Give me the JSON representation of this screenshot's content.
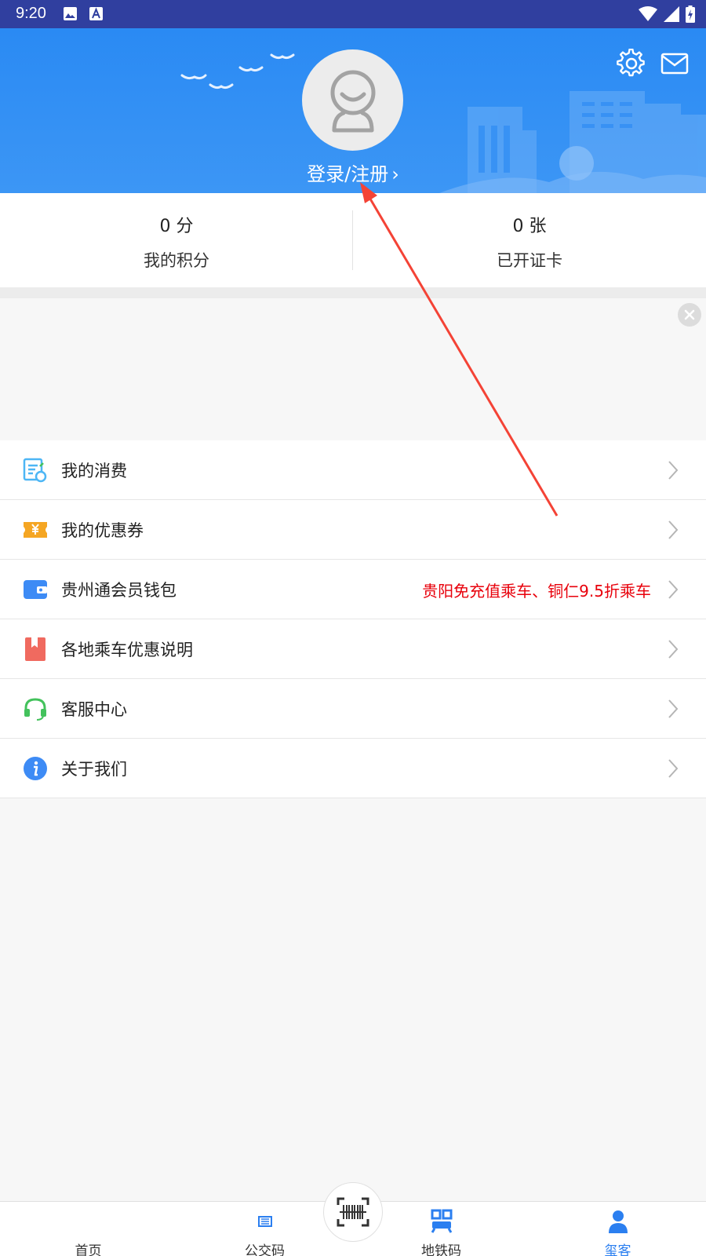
{
  "status_bar": {
    "time": "9:20"
  },
  "profile": {
    "login_label": "登录/注册",
    "chevron": "›"
  },
  "stats": [
    {
      "value": "0 分",
      "label": "我的积分"
    },
    {
      "value": "0 张",
      "label": "已开证卡"
    }
  ],
  "menu": [
    {
      "label": "我的消费",
      "icon": "receipt-icon",
      "color": "#4db6f5",
      "note": ""
    },
    {
      "label": "我的优惠券",
      "icon": "coupon-icon",
      "color": "#f5a623",
      "note": ""
    },
    {
      "label": "贵州通会员钱包",
      "icon": "wallet-icon",
      "color": "#3d8bf5",
      "note": "贵阳免充值乘车、铜仁9.5折乘车"
    },
    {
      "label": "各地乘车优惠说明",
      "icon": "bookmark-icon",
      "color": "#f06a5f",
      "note": ""
    },
    {
      "label": "客服中心",
      "icon": "headset-icon",
      "color": "#43c25c",
      "note": ""
    },
    {
      "label": "关于我们",
      "icon": "info-icon",
      "color": "#3d8bf5",
      "note": ""
    }
  ],
  "tabs": [
    {
      "label": "首页",
      "icon": "home-icon"
    },
    {
      "label": "公交码",
      "icon": "bus-code-icon"
    },
    {
      "label": "地铁码",
      "icon": "metro-code-icon"
    },
    {
      "label": "玺客",
      "icon": "user-icon"
    }
  ],
  "colors": {
    "accent": "#2b7ff0",
    "hero": "#2a8af3",
    "note": "#e8000b",
    "status_bar": "#303f9f",
    "annotation": "#f44336"
  }
}
